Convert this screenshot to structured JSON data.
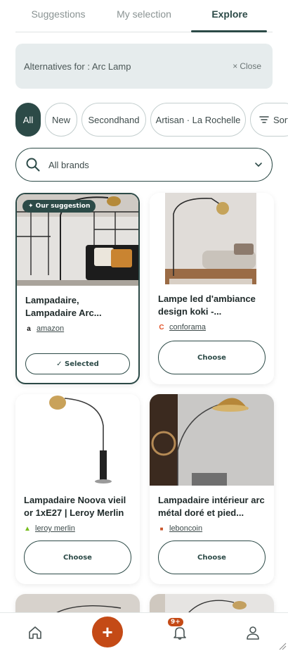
{
  "tabs": [
    {
      "label": "Suggestions",
      "active": false
    },
    {
      "label": "My selection",
      "active": false
    },
    {
      "label": "Explore",
      "active": true
    }
  ],
  "banner": {
    "title": "Alternatives for : Arc Lamp",
    "close_label": "Close",
    "close_icon": "close-icon"
  },
  "filters": {
    "chips": [
      "All",
      "New",
      "Secondhand",
      "Artisan · La Rochelle"
    ],
    "active": "All",
    "sort_label": "Sort"
  },
  "brand_select": {
    "value": "All brands"
  },
  "products": [
    {
      "title": "Lampadaire, Lampadaire Arc...",
      "shop": "amazon",
      "shop_logo": "a",
      "button_label": "✓ Selected",
      "badge": "✦ Our suggestion",
      "selected": true
    },
    {
      "title": "Lampe led d'ambiance design koki -...",
      "shop": "conforama",
      "shop_logo": "C",
      "button_label": "Choose",
      "selected": false
    },
    {
      "title": "Lampadaire Noova vieil or 1xE27 | Leroy Merlin",
      "shop": "leroy merlin",
      "shop_logo": "▲",
      "button_label": "Choose",
      "selected": false
    },
    {
      "title": "Lampadaire intérieur arc métal doré et pied...",
      "shop": "leboncoin",
      "shop_logo": "■",
      "button_label": "Choose",
      "selected": false
    }
  ],
  "bottom_nav": {
    "notifications_count": "9+",
    "items": [
      "home-icon",
      "add-button",
      "bell-icon",
      "profile-icon"
    ]
  },
  "colors": {
    "primary": "#2c4a47",
    "accent": "#c44a16",
    "banner_bg": "#e6eced",
    "amazon": "#ff9900",
    "conforama": "#e2542a",
    "leroy": "#78be20",
    "leboncoin": "#c9552a"
  }
}
